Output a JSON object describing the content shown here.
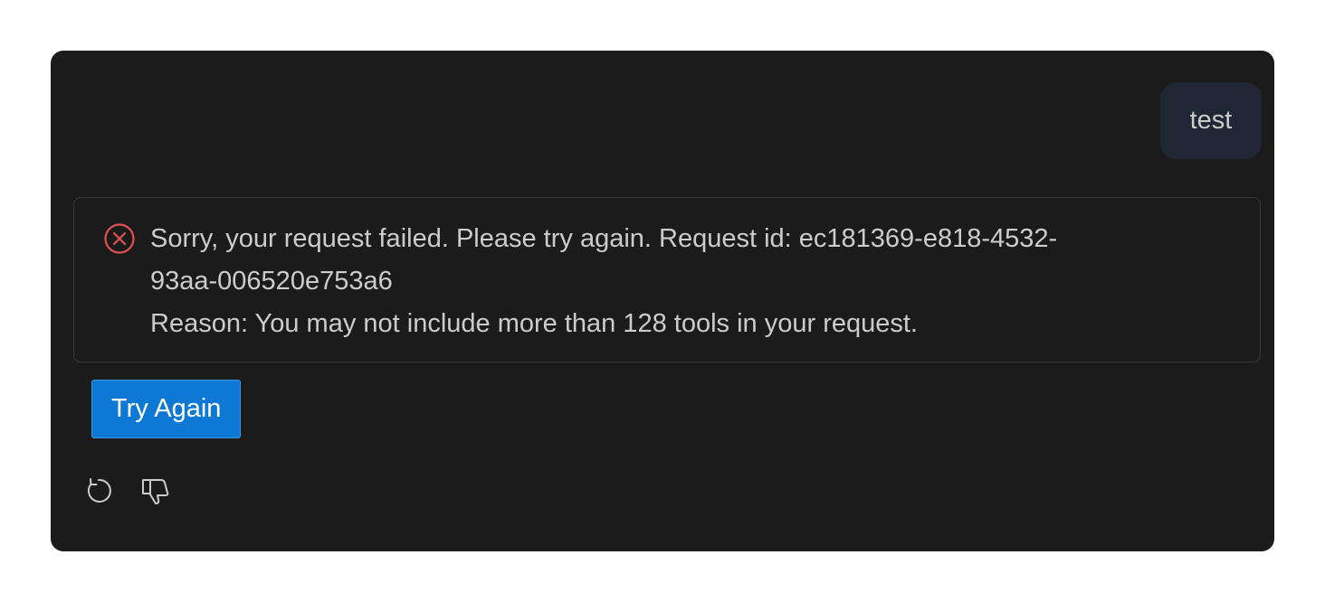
{
  "chat": {
    "user_message": "test"
  },
  "error": {
    "icon": "error-circle-icon",
    "icon_color": "#e05252",
    "line1": "Sorry, your request failed. Please try again. Request id: ec181369-e818-4532-",
    "line2": "93aa-006520e753a6",
    "line3": "Reason: You may not include more than 128 tools in your request."
  },
  "buttons": {
    "try_again_label": "Try Again"
  },
  "actions": {
    "retry_icon": "refresh-icon",
    "dislike_icon": "thumbs-down-icon"
  },
  "colors": {
    "panel_bg": "#1b1b1c",
    "user_bubble_bg": "#1e2733",
    "accent": "#0e78d5",
    "text": "#cccccc"
  }
}
